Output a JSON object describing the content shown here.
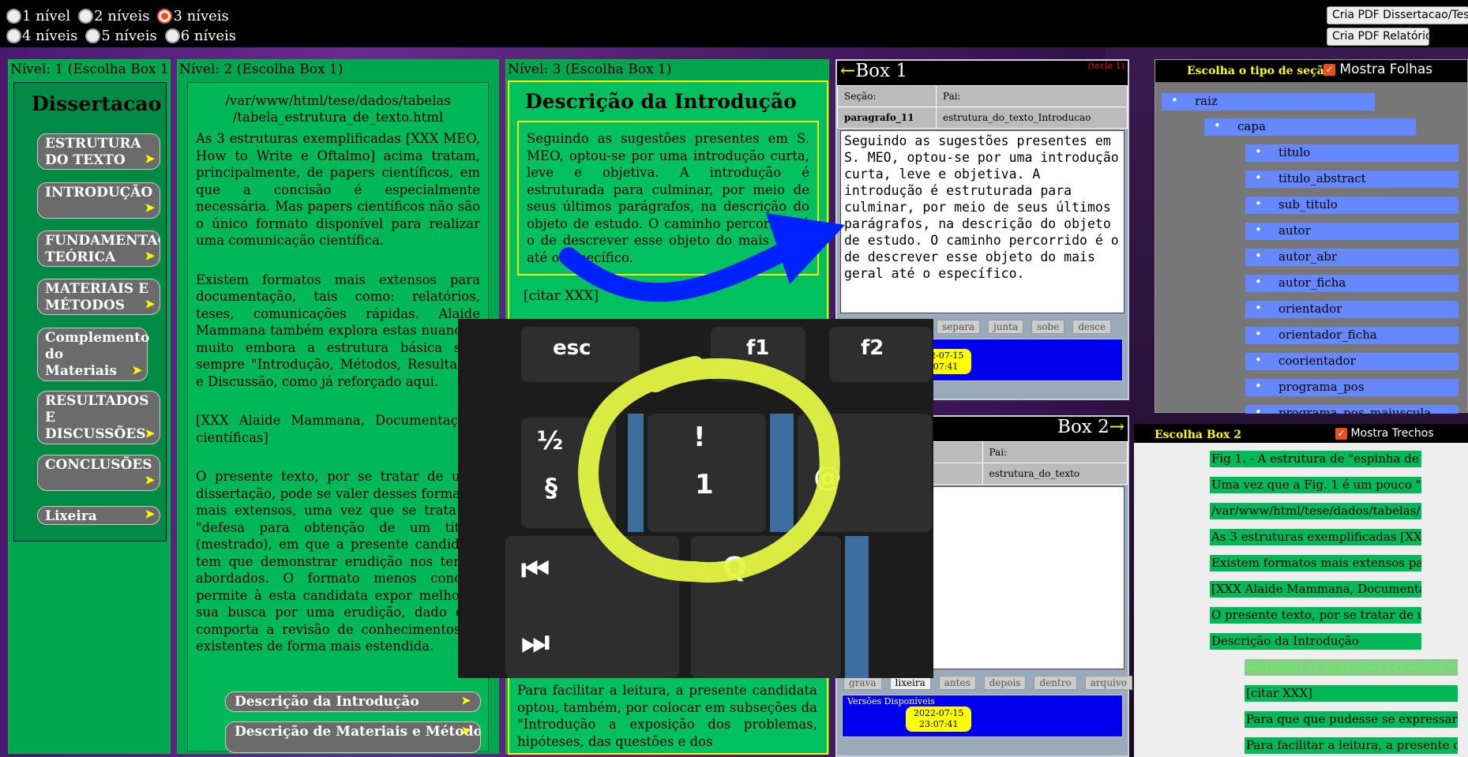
{
  "levels": [
    "1 nível",
    "2 níveis",
    "3 níveis",
    "4 níveis",
    "5 níveis",
    "6 níveis"
  ],
  "levels_selected": "3 níveis",
  "top_buttons": {
    "pdf_tese": "Cria PDF Dissertacao/Tese",
    "pdf_relatorio": "Cria PDF Relatório"
  },
  "col1": {
    "header": "Nível: 1 (Escolha Box 1)",
    "title": "Dissertacao",
    "items": [
      "ESTRUTURA DO TEXTO",
      "INTRODUÇÃO",
      "FUNDAMENTAÇÃO TEÓRICA",
      "MATERIAIS E MÉTODOS",
      "Complemento do Materiais",
      "RESULTADOS E DISCUSSÕES",
      "CONCLUSÕES",
      "Lixeira"
    ],
    "arrow": "➤"
  },
  "col2": {
    "header": "Nível: 2 (Escolha Box 1)",
    "path": "/var/www/html/tese/dados/tabelas /tabela_estrutura_de_texto.html",
    "paragraphs": [
      "As 3 estruturas exemplificadas [XXX MEO, How to Write e Oftalmo] acima tratam, principalmente, de papers científicos, em que a concisão é especialmente necessária. Mas papers científicos não são o único formato disponível para realizar uma comunicação científica.",
      "Existem formatos mais extensos para documentação, tais como: relatórios, teses, comunicações rápidas. Alaide Mammana também explora estas nuances, muito embora a estrutura básica seja sempre \"Introdução, Métodos, Resultados e Discussão, como já reforçado aqui.",
      "[XXX Alaide Mammana, Documentações científicas]",
      "O presente texto, por se tratar de uma dissertação, pode se valer desses formatos mais extensos, uma vez que se trata de \"defesa para obtenção de um título (mestrado), em que a presente candidata tem que demonstrar erudição nos temas abordados. O formato menos conciso permite à esta candidata expor melhor a sua busca por uma erudição, dado que comporta a revisão de conhecimentos já existentes de forma mais estendida."
    ],
    "sub_items": [
      "Descrição da Introdução",
      "Descrição de Materiais e Métodos"
    ]
  },
  "col3": {
    "header": "Nível: 3 (Escolha Box 1)",
    "title": "Descrição da Introdução",
    "para": "Seguindo as sugestões presentes em S. MEO, optou-se por uma introdução curta, leve e objetiva. A introdução é estruturada para culminar, por meio de seus últimos parágrafos, na descrição do objeto de estudo. O caminho percorrido é o de descrever esse objeto do mais geral até o específico.",
    "citar": "[citar XXX]",
    "bottom": "Para facilitar a leitura, a presente candidata optou, também, por colocar em subseções da \"Introdução a exposição dos problemas, hipóteses, das questões e dos"
  },
  "box1": {
    "title": "Box 1",
    "arrow_left": "←",
    "tecle": "(tecle 1)",
    "secao_label": "Seção:",
    "pai_label": "Pai:",
    "secao": "paragrafo_11",
    "pai": "estrutura_do_texto_Introducao",
    "text": "Seguindo as sugestões presentes em S. MEO, optou-se por uma introdução curta, leve e objetiva. A introdução é estruturada para culminar, por meio de seus últimos parágrafos, na descrição do objeto de estudo. O caminho percorrido é o de descrever esse objeto do mais geral até o específico.",
    "tools": [
      "separa",
      "junta",
      "sobe",
      "desce"
    ],
    "version_date": "2022-07-15",
    "version_time": "23:07:41"
  },
  "box2": {
    "title": "Box 2",
    "arrow_right": "→",
    "pai_label": "Pai:",
    "pai": "estrutura_do_texto",
    "tools": [
      "grava",
      "lixeira",
      "antes",
      "depois",
      "dentro",
      "arquivo"
    ],
    "versions_label": "Versões Disponíveis",
    "version_date": "2022-07-15",
    "version_time": "23:07:41"
  },
  "tree": {
    "title": "Escolha o tipo de seção:",
    "mostra": "Mostra Folhas",
    "nodes": [
      "raiz",
      "capa",
      "titulo",
      "titulo_abstract",
      "sub_titulo",
      "autor",
      "autor_abr",
      "autor_ficha",
      "orientador",
      "orientador_ficha",
      "coorientador",
      "programa_pos",
      "programa_pos_maiuscula"
    ]
  },
  "box2_list": {
    "title": "Escolha Box 2",
    "mostra": "Mostra Trechos",
    "items": [
      "Fig 1. - A estrutura de \"espinha de peixe",
      "Uma vez que a Fig. 1 é um pouco \"confusa",
      "/var/www/html/tese/dados/tabelas/tabela",
      "As 3 estruturas exemplificadas [XXX MEO",
      "Existem formatos mais extensos para doc",
      "[XXX Alaide Mammana, Documentações",
      "O presente texto, por se tratar de uma dis",
      "Descrição da Introdução",
      "Seguindo as sugestões presentes em S. MEO",
      "[citar XXX]",
      "Para que que pudesse se expressar de",
      "Para facilitar a leitura, a presente candi"
    ]
  },
  "photo_keys": [
    "esc",
    "f1",
    "f2",
    "½",
    "§",
    "!",
    "1",
    "@",
    "Q"
  ]
}
